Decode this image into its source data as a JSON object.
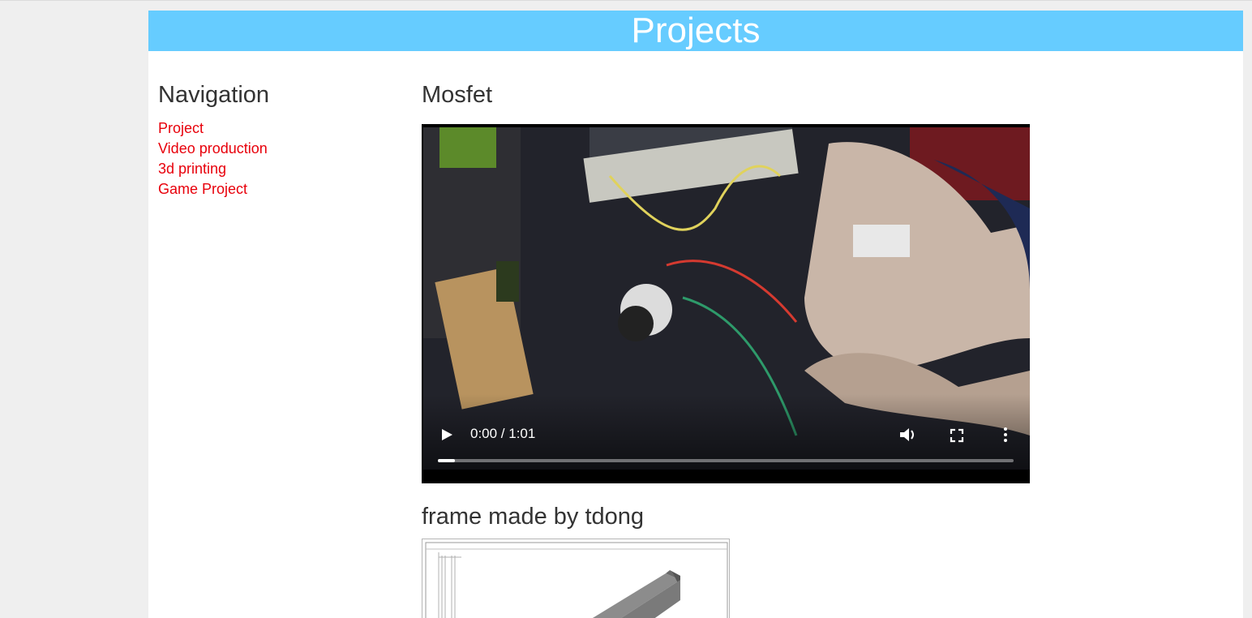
{
  "header": {
    "title": "Projects"
  },
  "navigation": {
    "title": "Navigation",
    "links": [
      {
        "label": "Project"
      },
      {
        "label": "Video production"
      },
      {
        "label": "3d printing"
      },
      {
        "label": "Game Project"
      }
    ]
  },
  "content": {
    "sections": [
      {
        "title": "Mosfet",
        "video": {
          "time": "0:00 / 1:01",
          "progress": 0.03
        }
      },
      {
        "title": "frame made by tdong"
      }
    ]
  },
  "colors": {
    "banner": "#66ccff",
    "link": "#e8000b",
    "text": "#333333"
  }
}
